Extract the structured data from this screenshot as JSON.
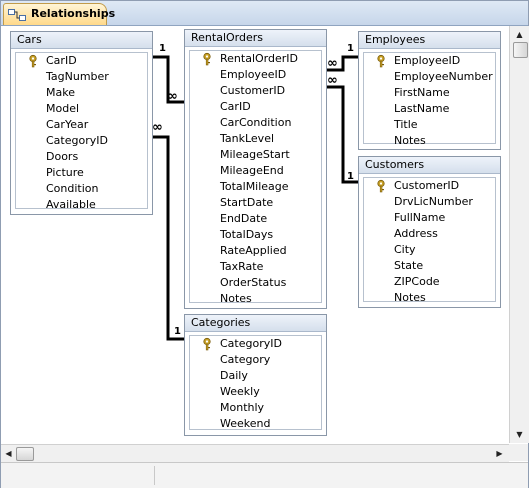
{
  "document_tab": {
    "label": "Relationships",
    "icon": "relationships-icon"
  },
  "tables": [
    {
      "name": "Cars",
      "fields": [
        {
          "name": "CarID",
          "key": true
        },
        {
          "name": "TagNumber"
        },
        {
          "name": "Make"
        },
        {
          "name": "Model"
        },
        {
          "name": "CarYear"
        },
        {
          "name": "CategoryID"
        },
        {
          "name": "Doors"
        },
        {
          "name": "Picture"
        },
        {
          "name": "Condition"
        },
        {
          "name": "Available"
        }
      ]
    },
    {
      "name": "RentalOrders",
      "fields": [
        {
          "name": "RentalOrderID",
          "key": true
        },
        {
          "name": "EmployeeID"
        },
        {
          "name": "CustomerID"
        },
        {
          "name": "CarID"
        },
        {
          "name": "CarCondition"
        },
        {
          "name": "TankLevel"
        },
        {
          "name": "MileageStart"
        },
        {
          "name": "MileageEnd"
        },
        {
          "name": "TotalMileage"
        },
        {
          "name": "StartDate"
        },
        {
          "name": "EndDate"
        },
        {
          "name": "TotalDays"
        },
        {
          "name": "RateApplied"
        },
        {
          "name": "TaxRate"
        },
        {
          "name": "OrderStatus"
        },
        {
          "name": "Notes"
        }
      ]
    },
    {
      "name": "Employees",
      "fields": [
        {
          "name": "EmployeeID",
          "key": true
        },
        {
          "name": "EmployeeNumber"
        },
        {
          "name": "FirstName"
        },
        {
          "name": "LastName"
        },
        {
          "name": "Title"
        },
        {
          "name": "Notes"
        }
      ]
    },
    {
      "name": "Customers",
      "fields": [
        {
          "name": "CustomerID",
          "key": true
        },
        {
          "name": "DrvLicNumber"
        },
        {
          "name": "FullName"
        },
        {
          "name": "Address"
        },
        {
          "name": "City"
        },
        {
          "name": "State"
        },
        {
          "name": "ZIPCode"
        },
        {
          "name": "Notes"
        }
      ]
    },
    {
      "name": "Categories",
      "fields": [
        {
          "name": "CategoryID",
          "key": true
        },
        {
          "name": "Category"
        },
        {
          "name": "Daily"
        },
        {
          "name": "Weekly"
        },
        {
          "name": "Monthly"
        },
        {
          "name": "Weekend"
        }
      ]
    }
  ],
  "relationships": [
    {
      "from": "Cars.CarID",
      "to": "RentalOrders.CarID",
      "one": "1",
      "many": "∞"
    },
    {
      "from": "Employees.EmployeeID",
      "to": "RentalOrders.EmployeeID",
      "one": "1",
      "many": "∞"
    },
    {
      "from": "Customers.CustomerID",
      "to": "RentalOrders.CustomerID",
      "one": "1",
      "many": "∞"
    },
    {
      "from": "Categories.CategoryID",
      "to": "Cars.CategoryID",
      "one": "1",
      "many": "∞"
    }
  ],
  "scrollbars": {
    "up": "▲",
    "down": "▼",
    "left": "◀",
    "right": "▶"
  },
  "colors": {
    "tab_active": "#ffd98a",
    "header": "#d5dfec",
    "key_icon": "#c9a227"
  }
}
